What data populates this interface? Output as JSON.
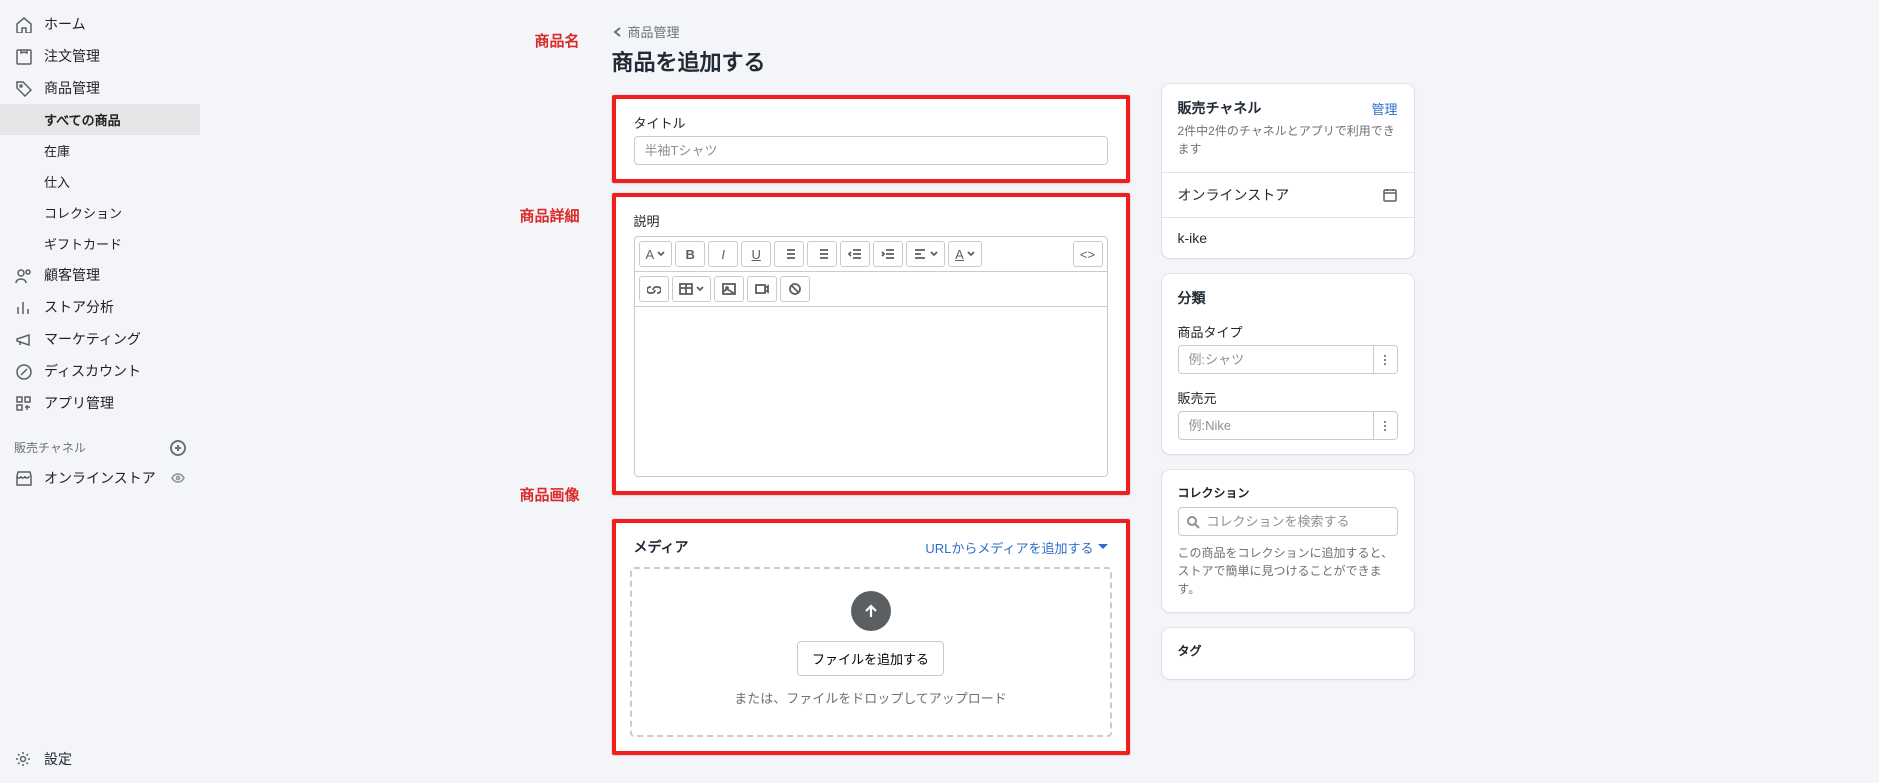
{
  "sidebar": {
    "home": "ホーム",
    "orders": "注文管理",
    "products": "商品管理",
    "sub": {
      "all": "すべての商品",
      "inventory": "在庫",
      "purchase": "仕入",
      "collections": "コレクション",
      "giftcards": "ギフトカード"
    },
    "customers": "顧客管理",
    "analytics": "ストア分析",
    "marketing": "マーケティング",
    "discounts": "ディスカウント",
    "apps": "アプリ管理",
    "channels_heading": "販売チャネル",
    "online_store": "オンラインストア",
    "settings": "設定"
  },
  "breadcrumb": "商品管理",
  "page_title": "商品を追加する",
  "labels": {
    "name": "商品名",
    "detail": "商品詳細",
    "image": "商品画像"
  },
  "title_block": {
    "label": "タイトル",
    "placeholder": "半袖Tシャツ"
  },
  "desc_block": {
    "label": "説明"
  },
  "toolbar": {
    "format": "A",
    "bold": "B",
    "italic": "I",
    "underline": "U",
    "code": "<>"
  },
  "media": {
    "title": "メディア",
    "add_url": "URLからメディアを追加する",
    "add_file": "ファイルを追加する",
    "drop_text": "または、ファイルをドロップしてアップロード"
  },
  "channels": {
    "title": "販売チャネル",
    "manage": "管理",
    "sub": "2件中2件のチャネルとアプリで利用できます",
    "online": "オンラインストア",
    "kike": "k-ike"
  },
  "classify": {
    "title": "分類",
    "type_label": "商品タイプ",
    "type_placeholder": "例:シャツ",
    "vendor_label": "販売元",
    "vendor_placeholder": "例:Nike"
  },
  "collection": {
    "title": "コレクション",
    "placeholder": "コレクションを検索する",
    "help": "この商品をコレクションに追加すると、ストアで簡単に見つけることができます。"
  },
  "tags": {
    "title": "タグ"
  }
}
